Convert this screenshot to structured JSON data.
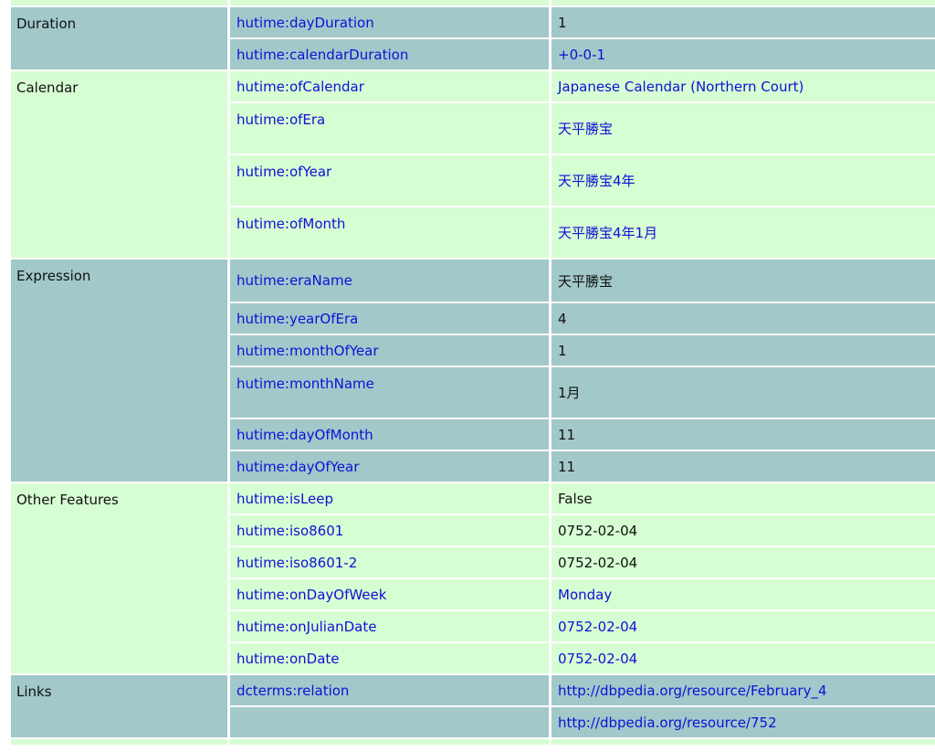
{
  "groups": [
    {
      "label": "Duration",
      "rows": [
        {
          "property": "hutime:dayDuration",
          "value": "1",
          "value_is_link": false
        },
        {
          "property": "hutime:calendarDuration",
          "value": "+0-0-1",
          "value_is_link": true
        }
      ]
    },
    {
      "label": "Calendar",
      "rows": [
        {
          "property": "hutime:ofCalendar",
          "value": "Japanese Calendar (Northern Court)",
          "value_is_link": true
        },
        {
          "property": "hutime:ofEra",
          "value": "天平勝宝",
          "value_is_link": true
        },
        {
          "property": "hutime:ofYear",
          "value": "天平勝宝4年",
          "value_is_link": true
        },
        {
          "property": "hutime:ofMonth",
          "value": "天平勝宝4年1月",
          "value_is_link": true
        }
      ]
    },
    {
      "label": "Expression",
      "rows": [
        {
          "property": "hutime:eraName",
          "value": "天平勝宝",
          "value_is_link": false
        },
        {
          "property": "hutime:yearOfEra",
          "value": "4",
          "value_is_link": false
        },
        {
          "property": "hutime:monthOfYear",
          "value": "1",
          "value_is_link": false
        },
        {
          "property": "hutime:monthName",
          "value": "1月",
          "value_is_link": false
        },
        {
          "property": "hutime:dayOfMonth",
          "value": "11",
          "value_is_link": false
        },
        {
          "property": "hutime:dayOfYear",
          "value": "11",
          "value_is_link": false
        }
      ]
    },
    {
      "label": "Other Features",
      "rows": [
        {
          "property": "hutime:isLeep",
          "value": "False",
          "value_is_link": false
        },
        {
          "property": "hutime:iso8601",
          "value": "0752-02-04",
          "value_is_link": false
        },
        {
          "property": "hutime:iso8601-2",
          "value": "0752-02-04",
          "value_is_link": false
        },
        {
          "property": "hutime:onDayOfWeek",
          "value": "Monday",
          "value_is_link": true
        },
        {
          "property": "hutime:onJulianDate",
          "value": "0752-02-04",
          "value_is_link": true
        },
        {
          "property": "hutime:onDate",
          "value": "0752-02-04",
          "value_is_link": true
        }
      ]
    },
    {
      "label": "Links",
      "rows": [
        {
          "property": "dcterms:relation",
          "value": "http://dbpedia.org/resource/February_4",
          "value_is_link": true
        },
        {
          "property": "",
          "value": "http://dbpedia.org/resource/752",
          "value_is_link": true
        }
      ]
    }
  ],
  "colors": {
    "row_blue": "#a2c8ca",
    "row_green": "#d7fdd2",
    "link": "#1010d6",
    "text": "#111111"
  }
}
